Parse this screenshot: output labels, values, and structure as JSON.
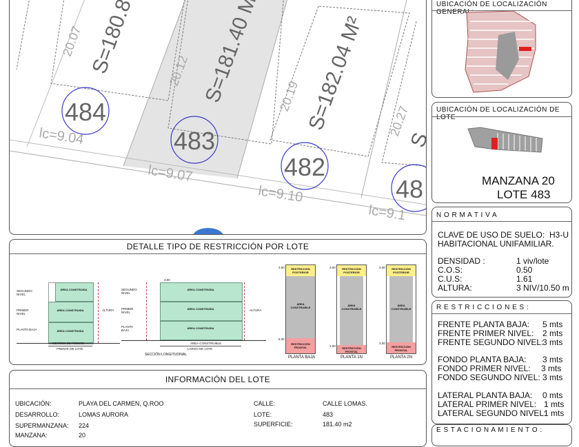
{
  "plan": {
    "lots": [
      {
        "number": "484",
        "area": "S=180.8",
        "depth": "20.07",
        "front": "lc=9.04"
      },
      {
        "number": "483",
        "area": "S=181.40 M",
        "depth": "20.12",
        "front": "lc=9.07"
      },
      {
        "number": "482",
        "area": "S=182.04 M²",
        "depth": "20.19",
        "front": "lc=9.10"
      },
      {
        "number": "48",
        "area": "S",
        "depth": "20.27",
        "front": "lc=9.1"
      }
    ]
  },
  "general_location": {
    "title": "UBICACIÓN DE LOCALIZACIÓN GENERAL:"
  },
  "lot_location": {
    "title": "UBICACIÓN DE LOCALIZACIÓN DE LOTE",
    "manzana": "MANZANA 20",
    "lote": "LOTE 483"
  },
  "normativa": {
    "title": "N O R M A T I V A",
    "clave_label": "CLAVE DE USO DE SUELO:",
    "clave_value": "H3-U",
    "uso": "HABITACIONAL UNIFAMILIAR.",
    "items": [
      {
        "label": "DENSIDAD :",
        "value": "1 viv/lote"
      },
      {
        "label": "C.O.S:",
        "value": "0.50"
      },
      {
        "label": "C.U.S:",
        "value": "1.61"
      },
      {
        "label": "ALTURA:",
        "value": "3 NIV/10.50 m"
      }
    ]
  },
  "restricciones": {
    "title": "R E S T R I C C I O N E S :",
    "groups": [
      [
        {
          "label": "FRENTE PLANTA BAJA:",
          "value": "5 mts"
        },
        {
          "label": "FRENTE PRIMER NIVEL:",
          "value": "2 mts"
        },
        {
          "label": "FRENTE SEGUNDO NIVEL:",
          "value": "3 mts"
        }
      ],
      [
        {
          "label": "FONDO PLANTA BAJA:",
          "value": "3 mts"
        },
        {
          "label": "FONDO PRIMER NIVEL:",
          "value": "3 mts"
        },
        {
          "label": "FONDO SEGUNDO NIVEL:",
          "value": "3 mts"
        }
      ],
      [
        {
          "label": "LATERAL PLANTA BAJA:",
          "value": "0 mts"
        },
        {
          "label": "LATERAL PRIMER NIVEL:",
          "value": "1 mts"
        },
        {
          "label": "LATERAL SEGUNDO NIVEL:",
          "value": "1 mts"
        }
      ]
    ]
  },
  "estacionamiento": {
    "title": "E S T A C I O N A M I E N T O :"
  },
  "detalle": {
    "title": "DETALLE TIPO DE RESTRICCIÓN POR LOTE",
    "area_construida": "ÁREA CONSTRUIDA",
    "niveles": [
      "SEGUNDO NIVEL",
      "PRIMER NIVEL",
      "PLANTA BAJA"
    ],
    "altura": "ALTURA",
    "metros_frente": "METROS DE FRENTE",
    "frente_lote": "FRENTE DE LOTE",
    "area_construible": "ÁREA CONSTRUIBLE",
    "largo_lote": "LARGO DE LOTE",
    "seccion": "SECCIÓN LONGITUDINAL",
    "restriccion_posterior": "RESTRICCIÓN POSTERIOR",
    "restriccion_frontal": "RESTRICCIÓN FRONTAL",
    "area_construible_plan": "ÁREA CONSTRUIBLE",
    "dims": {
      "top": "3.00",
      "bottom_pb": "5.00",
      "bottom_1n": "2.00",
      "bottom_2n": "3.00",
      "sec_top": "3.00"
    },
    "plans": [
      "PLANTA BAJA",
      "PLANTA 1N",
      "PLANTA 2N"
    ]
  },
  "info": {
    "title": "INFORMACIÓN DEL LOTE",
    "left": [
      {
        "label": "UBICACIÓN:",
        "value": "PLAYA DEL CARMEN, Q.ROO"
      },
      {
        "label": "DESARROLLO:",
        "value": "LOMAS AURORA"
      },
      {
        "label": "SUPERMANZANA:",
        "value": "224"
      },
      {
        "label": "MANZANA:",
        "value": "20"
      }
    ],
    "right": [
      {
        "label": "CALLE:",
        "value": "CALLE LOMAS."
      },
      {
        "label": "LOTE:",
        "value": "483"
      },
      {
        "label": "SUPERFICIE:",
        "value": "181.40 m2"
      }
    ]
  },
  "colors": {
    "built": "#b8e6cf",
    "rear": "#ffef8a",
    "front": "#f4a0a0",
    "lot_grey": "#bdbdbd",
    "plan_red": "#e02020"
  }
}
